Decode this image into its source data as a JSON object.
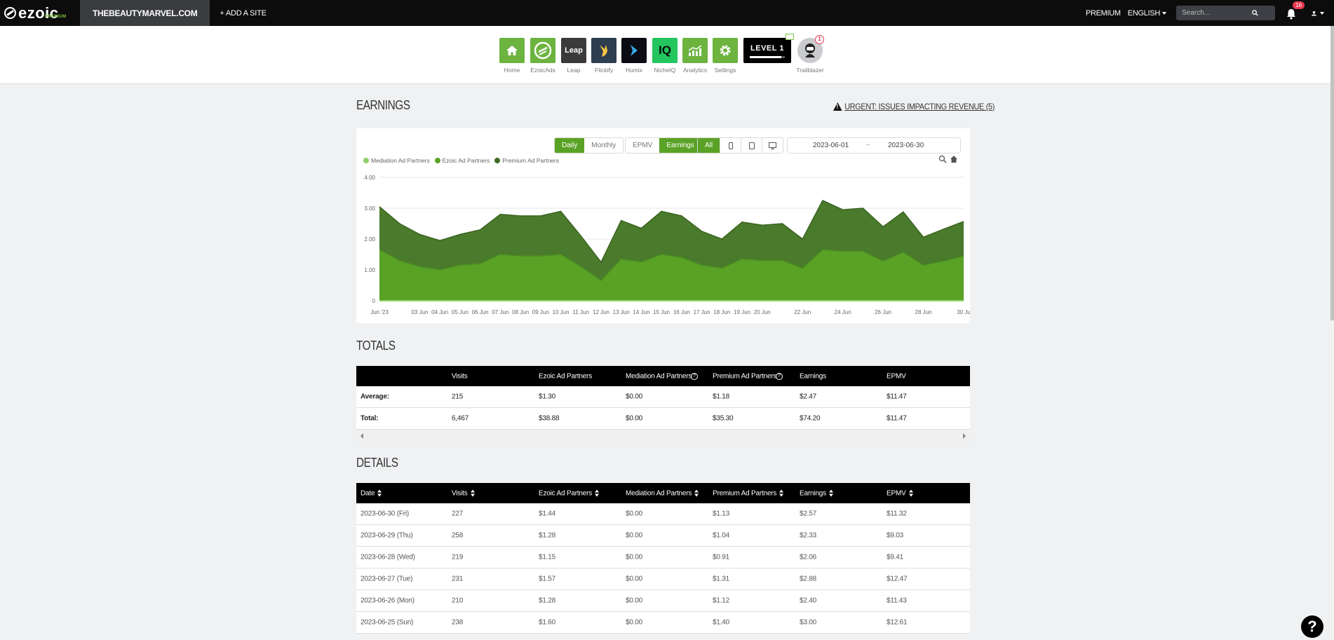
{
  "topbar": {
    "logo_text": "ezoic",
    "logo_sub": "PREMIUM",
    "site_name": "THEBEAUTYMARVEL.COM",
    "add_site": "+ ADD A SITE",
    "premium": "PREMIUM",
    "language": "ENGLISH",
    "search_placeholder": "Search...",
    "notification_count": "16"
  },
  "apps": [
    {
      "label": "Home",
      "color": "#6cb33f"
    },
    {
      "label": "EzoicAds",
      "color": "#6cb33f"
    },
    {
      "label": "Leap",
      "color": "#3a3a3a"
    },
    {
      "label": "Flickify",
      "color": "#2c3e50"
    },
    {
      "label": "Humix",
      "color": "#0b0b14"
    },
    {
      "label": "NicheIQ",
      "color": "#22c55e"
    },
    {
      "label": "Analytics",
      "color": "#6cb33f"
    },
    {
      "label": "Settings",
      "color": "#6cb33f"
    }
  ],
  "level": {
    "label": "LEVEL 1",
    "progress": 0.9
  },
  "trailblazer": {
    "label": "Trailblazer",
    "badge": "1"
  },
  "earnings": {
    "title": "EARNINGS",
    "urgent": "URGENT: ISSUES IMPACTING REVENUE (5)",
    "period_buttons": [
      "Daily",
      "Monthly"
    ],
    "metric_buttons": [
      "EPMV",
      "Earnings"
    ],
    "device_all": "All",
    "date_from": "2023-06-01",
    "date_sep": "~",
    "date_to": "2023-06-30"
  },
  "chart_data": {
    "type": "area",
    "stacked": true,
    "x_tick_labels": [
      "Jun '23",
      "03 Jun",
      "04 Jun",
      "05 Jun",
      "06 Jun",
      "07 Jun",
      "08 Jun",
      "09 Jun",
      "10 Jun",
      "11 Jun",
      "12 Jun",
      "13 Jun",
      "14 Jun",
      "15 Jun",
      "16 Jun",
      "17 Jun",
      "18 Jun",
      "19 Jun",
      "20 Jun",
      "22 Jun",
      "24 Jun",
      "26 Jun",
      "28 Jun",
      "30 Ju"
    ],
    "y_ticks": [
      "0",
      "1.00",
      "2.00",
      "3.00",
      "4.00"
    ],
    "ylim": [
      0,
      4
    ],
    "legend": "top-left",
    "series": [
      {
        "name": "Mediation Ad Partners",
        "color": "#8fd06a",
        "values": [
          0,
          0,
          0,
          0,
          0,
          0,
          0,
          0,
          0,
          0,
          0,
          0,
          0,
          0,
          0,
          0,
          0,
          0,
          0,
          0,
          0,
          0,
          0,
          0,
          0,
          0,
          0,
          0,
          0,
          0
        ]
      },
      {
        "name": "Ezoic Ad Partners",
        "color": "#5aa226",
        "values": [
          1.65,
          1.3,
          1.1,
          1.0,
          1.15,
          1.2,
          1.5,
          1.45,
          1.45,
          1.5,
          1.1,
          0.65,
          1.35,
          1.25,
          1.5,
          1.4,
          1.15,
          1.05,
          1.35,
          1.3,
          1.3,
          1.05,
          1.65,
          1.6,
          1.6,
          1.28,
          1.57,
          1.15,
          1.28,
          1.44
        ]
      },
      {
        "name": "Premium Ad Partners",
        "color": "#4a7a2c",
        "values": [
          1.4,
          1.2,
          1.05,
          0.95,
          1.0,
          1.1,
          1.3,
          1.3,
          1.3,
          1.4,
          1.0,
          0.6,
          1.25,
          1.1,
          1.4,
          1.35,
          1.1,
          0.95,
          1.2,
          1.15,
          1.2,
          0.95,
          1.6,
          1.35,
          1.4,
          1.12,
          1.31,
          0.91,
          1.04,
          1.13
        ]
      }
    ]
  },
  "totals": {
    "title": "TOTALS",
    "columns": [
      "",
      "Visits",
      "Ezoic Ad Partners",
      "Mediation Ad Partners",
      "Premium Ad Partners",
      "Earnings",
      "EPMV"
    ],
    "rows": [
      [
        "Average:",
        "215",
        "$1.30",
        "$0.00",
        "$1.18",
        "$2.47",
        "$11.47"
      ],
      [
        "Total:",
        "6,467",
        "$38.88",
        "$0.00",
        "$35.30",
        "$74.20",
        "$11.47"
      ]
    ]
  },
  "details": {
    "title": "DETAILS",
    "columns": [
      "Date",
      "Visits",
      "Ezoic Ad Partners",
      "Mediation Ad Partners",
      "Premium Ad Partners",
      "Earnings",
      "EPMV"
    ],
    "rows": [
      [
        "2023-06-30 (Fri)",
        "227",
        "$1.44",
        "$0.00",
        "$1.13",
        "$2.57",
        "$11.32"
      ],
      [
        "2023-06-29 (Thu)",
        "258",
        "$1.28",
        "$0.00",
        "$1.04",
        "$2.33",
        "$9.03"
      ],
      [
        "2023-06-28 (Wed)",
        "219",
        "$1.15",
        "$0.00",
        "$0.91",
        "$2.06",
        "$9.41"
      ],
      [
        "2023-06-27 (Tue)",
        "231",
        "$1.57",
        "$0.00",
        "$1.31",
        "$2.88",
        "$12.47"
      ],
      [
        "2023-06-26 (Mon)",
        "210",
        "$1.28",
        "$0.00",
        "$1.12",
        "$2.40",
        "$11.43"
      ],
      [
        "2023-06-25 (Sun)",
        "238",
        "$1.60",
        "$0.00",
        "$1.40",
        "$3.00",
        "$12.61"
      ]
    ]
  },
  "help_label": "?"
}
